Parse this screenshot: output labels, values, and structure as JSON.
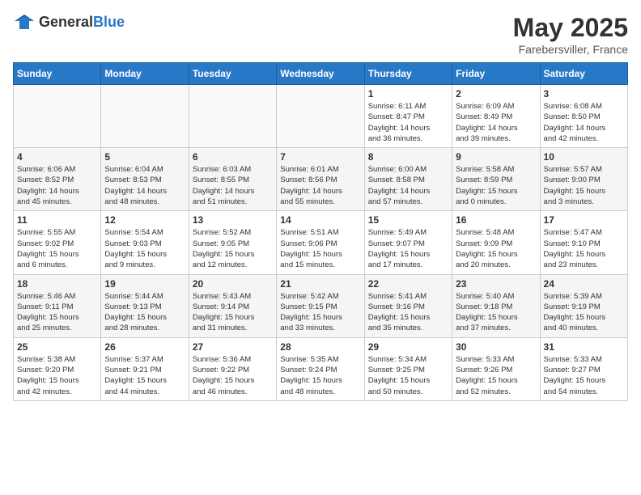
{
  "header": {
    "logo_general": "General",
    "logo_blue": "Blue",
    "title": "May 2025",
    "subtitle": "Farebersviller, France"
  },
  "weekdays": [
    "Sunday",
    "Monday",
    "Tuesday",
    "Wednesday",
    "Thursday",
    "Friday",
    "Saturday"
  ],
  "weeks": [
    [
      {
        "day": "",
        "info": ""
      },
      {
        "day": "",
        "info": ""
      },
      {
        "day": "",
        "info": ""
      },
      {
        "day": "",
        "info": ""
      },
      {
        "day": "1",
        "info": "Sunrise: 6:11 AM\nSunset: 8:47 PM\nDaylight: 14 hours\nand 36 minutes."
      },
      {
        "day": "2",
        "info": "Sunrise: 6:09 AM\nSunset: 8:49 PM\nDaylight: 14 hours\nand 39 minutes."
      },
      {
        "day": "3",
        "info": "Sunrise: 6:08 AM\nSunset: 8:50 PM\nDaylight: 14 hours\nand 42 minutes."
      }
    ],
    [
      {
        "day": "4",
        "info": "Sunrise: 6:06 AM\nSunset: 8:52 PM\nDaylight: 14 hours\nand 45 minutes."
      },
      {
        "day": "5",
        "info": "Sunrise: 6:04 AM\nSunset: 8:53 PM\nDaylight: 14 hours\nand 48 minutes."
      },
      {
        "day": "6",
        "info": "Sunrise: 6:03 AM\nSunset: 8:55 PM\nDaylight: 14 hours\nand 51 minutes."
      },
      {
        "day": "7",
        "info": "Sunrise: 6:01 AM\nSunset: 8:56 PM\nDaylight: 14 hours\nand 55 minutes."
      },
      {
        "day": "8",
        "info": "Sunrise: 6:00 AM\nSunset: 8:58 PM\nDaylight: 14 hours\nand 57 minutes."
      },
      {
        "day": "9",
        "info": "Sunrise: 5:58 AM\nSunset: 8:59 PM\nDaylight: 15 hours\nand 0 minutes."
      },
      {
        "day": "10",
        "info": "Sunrise: 5:57 AM\nSunset: 9:00 PM\nDaylight: 15 hours\nand 3 minutes."
      }
    ],
    [
      {
        "day": "11",
        "info": "Sunrise: 5:55 AM\nSunset: 9:02 PM\nDaylight: 15 hours\nand 6 minutes."
      },
      {
        "day": "12",
        "info": "Sunrise: 5:54 AM\nSunset: 9:03 PM\nDaylight: 15 hours\nand 9 minutes."
      },
      {
        "day": "13",
        "info": "Sunrise: 5:52 AM\nSunset: 9:05 PM\nDaylight: 15 hours\nand 12 minutes."
      },
      {
        "day": "14",
        "info": "Sunrise: 5:51 AM\nSunset: 9:06 PM\nDaylight: 15 hours\nand 15 minutes."
      },
      {
        "day": "15",
        "info": "Sunrise: 5:49 AM\nSunset: 9:07 PM\nDaylight: 15 hours\nand 17 minutes."
      },
      {
        "day": "16",
        "info": "Sunrise: 5:48 AM\nSunset: 9:09 PM\nDaylight: 15 hours\nand 20 minutes."
      },
      {
        "day": "17",
        "info": "Sunrise: 5:47 AM\nSunset: 9:10 PM\nDaylight: 15 hours\nand 23 minutes."
      }
    ],
    [
      {
        "day": "18",
        "info": "Sunrise: 5:46 AM\nSunset: 9:11 PM\nDaylight: 15 hours\nand 25 minutes."
      },
      {
        "day": "19",
        "info": "Sunrise: 5:44 AM\nSunset: 9:13 PM\nDaylight: 15 hours\nand 28 minutes."
      },
      {
        "day": "20",
        "info": "Sunrise: 5:43 AM\nSunset: 9:14 PM\nDaylight: 15 hours\nand 31 minutes."
      },
      {
        "day": "21",
        "info": "Sunrise: 5:42 AM\nSunset: 9:15 PM\nDaylight: 15 hours\nand 33 minutes."
      },
      {
        "day": "22",
        "info": "Sunrise: 5:41 AM\nSunset: 9:16 PM\nDaylight: 15 hours\nand 35 minutes."
      },
      {
        "day": "23",
        "info": "Sunrise: 5:40 AM\nSunset: 9:18 PM\nDaylight: 15 hours\nand 37 minutes."
      },
      {
        "day": "24",
        "info": "Sunrise: 5:39 AM\nSunset: 9:19 PM\nDaylight: 15 hours\nand 40 minutes."
      }
    ],
    [
      {
        "day": "25",
        "info": "Sunrise: 5:38 AM\nSunset: 9:20 PM\nDaylight: 15 hours\nand 42 minutes."
      },
      {
        "day": "26",
        "info": "Sunrise: 5:37 AM\nSunset: 9:21 PM\nDaylight: 15 hours\nand 44 minutes."
      },
      {
        "day": "27",
        "info": "Sunrise: 5:36 AM\nSunset: 9:22 PM\nDaylight: 15 hours\nand 46 minutes."
      },
      {
        "day": "28",
        "info": "Sunrise: 5:35 AM\nSunset: 9:24 PM\nDaylight: 15 hours\nand 48 minutes."
      },
      {
        "day": "29",
        "info": "Sunrise: 5:34 AM\nSunset: 9:25 PM\nDaylight: 15 hours\nand 50 minutes."
      },
      {
        "day": "30",
        "info": "Sunrise: 5:33 AM\nSunset: 9:26 PM\nDaylight: 15 hours\nand 52 minutes."
      },
      {
        "day": "31",
        "info": "Sunrise: 5:33 AM\nSunset: 9:27 PM\nDaylight: 15 hours\nand 54 minutes."
      }
    ]
  ]
}
